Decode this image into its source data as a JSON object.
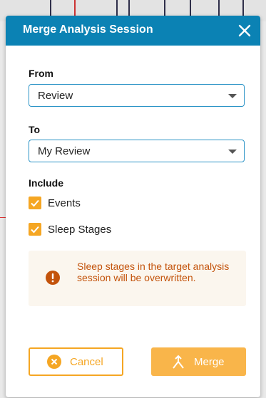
{
  "dialog": {
    "title": "Merge Analysis Session",
    "close_icon": "close-icon"
  },
  "from": {
    "label": "From",
    "value": "Review"
  },
  "to": {
    "label": "To",
    "value": "My Review"
  },
  "include": {
    "label": "Include",
    "options": [
      {
        "label": "Events",
        "checked": true
      },
      {
        "label": "Sleep Stages",
        "checked": true
      }
    ]
  },
  "warning": {
    "icon": "exclamation-circle-icon",
    "text": "Sleep stages in the target analysis session will be overwritten."
  },
  "buttons": {
    "cancel_label": "Cancel",
    "cancel_icon": "cancel-circle-icon",
    "merge_label": "Merge",
    "merge_icon": "merge-icon"
  },
  "colors": {
    "header": "#0b82b4",
    "accent": "#f5a623",
    "warning_text": "#c3530b"
  }
}
